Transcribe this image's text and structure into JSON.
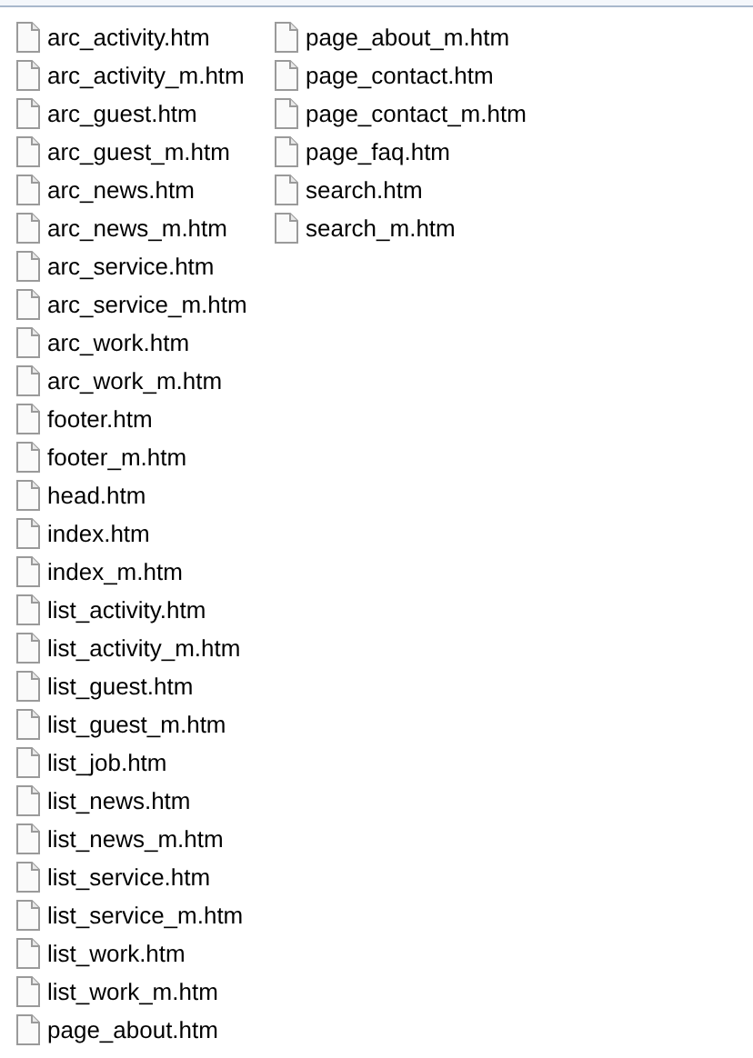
{
  "files": [
    {
      "name": "arc_activity.htm"
    },
    {
      "name": "arc_activity_m.htm"
    },
    {
      "name": "arc_guest.htm"
    },
    {
      "name": "arc_guest_m.htm"
    },
    {
      "name": "arc_news.htm"
    },
    {
      "name": "arc_news_m.htm"
    },
    {
      "name": "arc_service.htm"
    },
    {
      "name": "arc_service_m.htm"
    },
    {
      "name": "arc_work.htm"
    },
    {
      "name": "arc_work_m.htm"
    },
    {
      "name": "footer.htm"
    },
    {
      "name": "footer_m.htm"
    },
    {
      "name": "head.htm"
    },
    {
      "name": "index.htm"
    },
    {
      "name": "index_m.htm"
    },
    {
      "name": "list_activity.htm"
    },
    {
      "name": "list_activity_m.htm"
    },
    {
      "name": "list_guest.htm"
    },
    {
      "name": "list_guest_m.htm"
    },
    {
      "name": "list_job.htm"
    },
    {
      "name": "list_news.htm"
    },
    {
      "name": "list_news_m.htm"
    },
    {
      "name": "list_service.htm"
    },
    {
      "name": "list_service_m.htm"
    },
    {
      "name": "list_work.htm"
    },
    {
      "name": "list_work_m.htm"
    },
    {
      "name": "page_about.htm"
    },
    {
      "name": "page_about_m.htm"
    },
    {
      "name": "page_contact.htm"
    },
    {
      "name": "page_contact_m.htm"
    },
    {
      "name": "page_faq.htm"
    },
    {
      "name": "search.htm"
    },
    {
      "name": "search_m.htm"
    }
  ]
}
